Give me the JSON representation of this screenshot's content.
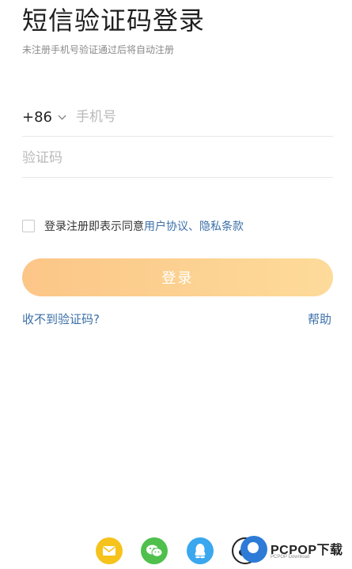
{
  "header": {
    "title": "短信验证码登录",
    "subtitle": "未注册手机号验证通过后将自动注册"
  },
  "phone": {
    "country_code": "+86",
    "placeholder": "手机号",
    "value": ""
  },
  "code": {
    "placeholder": "验证码",
    "value": ""
  },
  "agreement": {
    "checked": false,
    "prefix": "登录注册即表示同意",
    "user_agreement": "用户协议",
    "separator": "、",
    "privacy_policy": "隐私条款"
  },
  "login_button": {
    "label": "登录"
  },
  "links": {
    "no_code": "收不到验证码?",
    "help": "帮助"
  },
  "social": {
    "icons": [
      "mail-icon",
      "wechat-icon",
      "qq-icon",
      "weibo-icon"
    ],
    "colors": {
      "mail": "#f6c21c",
      "wechat": "#4fc04c",
      "qq": "#3aa7ef"
    }
  },
  "watermark": {
    "brand": "PCPOP下载",
    "sub": "PCPOP Download"
  },
  "theme": {
    "accent_link": "#3c6fa8",
    "button_gradient_start": "#fcc687",
    "button_gradient_end": "#fddb9a"
  }
}
